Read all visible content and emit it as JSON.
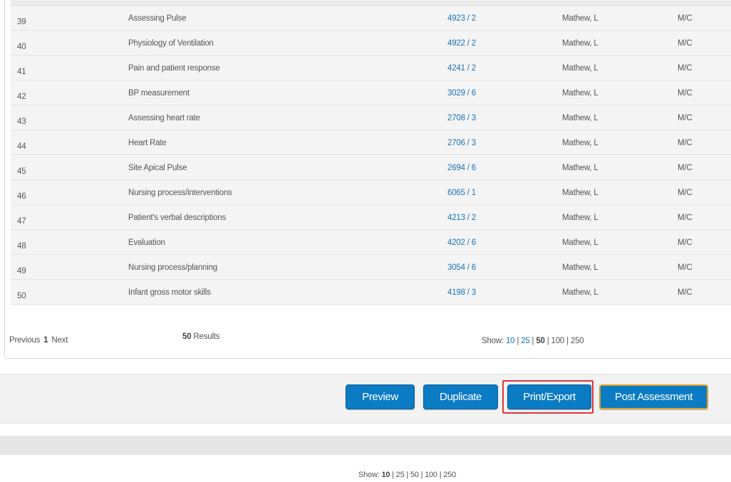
{
  "questions": [
    {
      "num": "39",
      "title": "Assessing Pulse",
      "item": "4923 / 2",
      "author": "Mathew, L",
      "type": "M/C"
    },
    {
      "num": "40",
      "title": "Physiology of Ventilation",
      "item": "4922 / 2",
      "author": "Mathew, L",
      "type": "M/C"
    },
    {
      "num": "41",
      "title": "Pain and patient response",
      "item": "4241 / 2",
      "author": "Mathew, L",
      "type": "M/C"
    },
    {
      "num": "42",
      "title": "BP measurement",
      "item": "3029 / 6",
      "author": "Mathew, L",
      "type": "M/C"
    },
    {
      "num": "43",
      "title": "Assessing heart rate",
      "item": "2708 / 3",
      "author": "Mathew, L",
      "type": "M/C"
    },
    {
      "num": "44",
      "title": "Heart Rate",
      "item": "2706 / 3",
      "author": "Mathew, L",
      "type": "M/C"
    },
    {
      "num": "45",
      "title": "Site Apical Pulse",
      "item": "2694 / 6",
      "author": "Mathew, L",
      "type": "M/C"
    },
    {
      "num": "46",
      "title": "Nursing process/interventions",
      "item": "6065 / 1",
      "author": "Mathew, L",
      "type": "M/C"
    },
    {
      "num": "47",
      "title": "Patient's verbal descriptions",
      "item": "4213 / 2",
      "author": "Mathew, L",
      "type": "M/C"
    },
    {
      "num": "48",
      "title": "Evaluation",
      "item": "4202 / 6",
      "author": "Mathew, L",
      "type": "M/C"
    },
    {
      "num": "49",
      "title": "Nursing process/planning",
      "item": "3054 / 6",
      "author": "Mathew, L",
      "type": "M/C"
    },
    {
      "num": "50",
      "title": "Infant gross motor skills",
      "item": "4198 / 3",
      "author": "Mathew, L",
      "type": "M/C"
    }
  ],
  "pagination": {
    "previous": "Previous",
    "current_page": "1",
    "next": "Next"
  },
  "results": {
    "count": "50",
    "label": "Results"
  },
  "page_size": {
    "label": "Show:",
    "options": [
      "10",
      "25",
      "50",
      "100",
      "250"
    ],
    "selected": "50"
  },
  "actions": {
    "preview": "Preview",
    "duplicate": "Duplicate",
    "print_export": "Print/Export",
    "post_assessment": "Post Assessment",
    "highlighted": "Print/Export"
  },
  "footer_page_size": {
    "label": "Show:",
    "options": [
      "10",
      "25",
      "50",
      "100",
      "250"
    ],
    "selected": "10"
  },
  "colors": {
    "link": "#1a73b8",
    "button": "#0b7bc4",
    "post_border": "#e0a12a",
    "highlight": "#e0353b",
    "row_bg": "#f4f4f4"
  }
}
